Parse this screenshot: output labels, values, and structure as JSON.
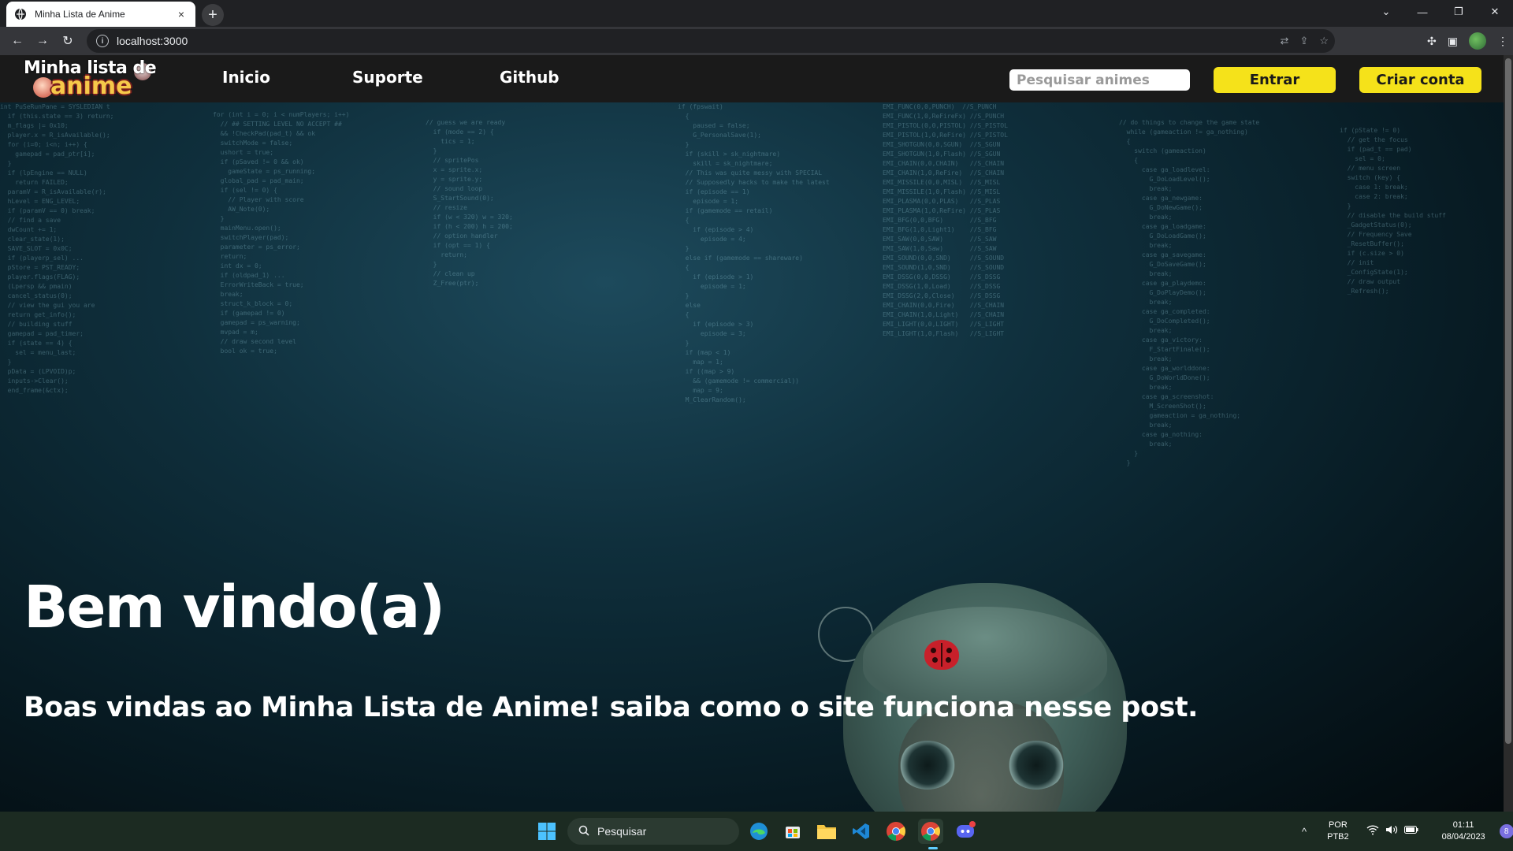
{
  "browser": {
    "tab_title": "Minha Lista de Anime",
    "tab_close": "×",
    "new_tab": "+",
    "url": "localhost:3000",
    "window_controls": {
      "dropdown": "⌄",
      "minimize": "—",
      "maximize": "❐",
      "close": "✕"
    },
    "nav": {
      "back": "←",
      "forward": "→",
      "reload": "↻",
      "info": "i"
    },
    "omnibox_icons": {
      "translate": "⇄",
      "share": "⇪",
      "bookmark": "☆"
    },
    "toolbar_icons": {
      "extensions": "✣",
      "sidepanel": "▣",
      "menu": "⋮"
    }
  },
  "site": {
    "logo_line1": "Minha lista de",
    "logo_line2": "anime",
    "nav_links": [
      "Inicio",
      "Suporte",
      "Github"
    ],
    "search_placeholder": "Pesquisar animes",
    "login_button": "Entrar",
    "signup_button": "Criar conta",
    "hero_title": "Bem vindo(a)",
    "hero_subtitle": "Boas vindas ao Minha Lista de Anime! saiba como o site funciona nesse post.",
    "colors": {
      "accent": "#f5e21a",
      "navbar": "#1a1a1a",
      "text": "#ffffff"
    }
  },
  "taskbar": {
    "search_label": "Pesquisar",
    "language": "POR",
    "keyboard": "PTB2",
    "time": "01:11",
    "date": "08/04/2023",
    "notification_count": "8",
    "chevron": "^",
    "apps": [
      "windows-start-icon",
      "edge-icon",
      "store-icon",
      "file-explorer-icon",
      "vscode-icon",
      "chrome-icon",
      "chrome-active-icon",
      "discord-icon"
    ]
  },
  "background_code": [
    "int PuSeRunPane = SYSLEDIAN t\n  if (this.state == 3) return;\n  m_flags |= 0x10;\n  player.x = R_isAvailable();\n  for (i=0; i<n; i++) {\n    gamepad = pad_ptr[i];\n  }\n  if (lpEngine == NULL)\n    return FAILED;\n  paramV = R_isAvailable(r);\n  hLevel = ENG_LEVEL;\n  if (paramV == 0) break;\n  // find a save\n  dwCount += 1;\n  clear_state(1);\n  SAVE_SLOT = 0x0C;\n  if (playerp_sel) ...\n  pStore = PST_READY;\n  player.flags(FLAG);\n  (Lpersp && pmain)\n  cancel_status(0);\n  // view the gui you are\n  return get_info();\n  // building stuff\n  gamepad = pad_timer;\n  if (state == 4) {\n    sel = menu_last;\n  }\n  pData = (LPVOID)p;\n  inputs->Clear();\n  end_frame(&ctx);",
    "for (int i = 0; i < numPlayers; i++)\n  // ## SETTING LEVEL NO ACCEPT ##\n  && !CheckPad(pad_t) && ok\n  switchMode = false;\n  ushort = true;\n  if (pSaved != 0 && ok)\n    gameState = ps_running;\n  global_pad = pad_main;\n  if (sel != 0) {\n    // Player with score\n    AW_Note(0);\n  }\n  mainMenu.open();\n  switchPlayer(pad);\n  parameter = ps_error;\n  return;\n  int dx = 0;\n  if (oldpad_1) ...\n  ErrorWriteBack = true;\n  break;\n  struct_k_block = 0;\n  if (gamepad != 0)\n  gamepad = ps_warning;\n  mvpad = m;\n  // draw second level\n  bool ok = true;",
    "if (pState != 0)\n  // get the focus\n  if (pad_t == pad)\n    sel = 0;\n  // menu screen\n  switch (key) {\n    case 1: break;\n    case 2: break;\n  }\n  // disable the build stuff\n  _GadgetStatus(0);\n  // Frequency Save\n  _ResetBuffer();\n  if (c.size > 0)\n  // init\n  _ConfigState(1);\n  // draw output\n  _Refresh();",
    "if (fpswait)\n  {\n    paused = false;\n    G_PersonalSave(1);\n  }\n  if (skill > sk_nightmare)\n    skill = sk_nightmare;\n  // This was quite messy with SPECIAL\n  // Supposedly hacks to make the latest\n  if (episode == 1)\n    episode = 1;\n  if (gamemode == retail)\n  {\n    if (episode > 4)\n      episode = 4;\n  }\n  else if (gamemode == shareware)\n  {\n    if (episode > 1)\n      episode = 1;\n  }\n  else\n  {\n    if (episode > 3)\n      episode = 3;\n  }\n  if (map < 1)\n    map = 1;\n  if ((map > 9)\n    && (gamemode != commercial))\n    map = 9;\n  M_ClearRandom();",
    "EMI_FUNC(0,0,PUNCH)  //S_PUNCH\nEMI_FUNC(1,0,ReFireFx) //S_PUNCH\nEMI_PISTOL(0,0,PISTOL) //S_PISTOL\nEMI_PISTOL(1,0,ReFire) //S_PISTOL\nEMI_SHOTGUN(0,0,SGUN)  //S_SGUN\nEMI_SHOTGUN(1,0,Flash) //S_SGUN\nEMI_CHAIN(0,0,CHAIN)   //S_CHAIN\nEMI_CHAIN(1,0,ReFire)  //S_CHAIN\nEMI_MISSILE(0,0,MISL)  //S_MISL\nEMI_MISSILE(1,0,Flash) //S_MISL\nEMI_PLASMA(0,0,PLAS)   //S_PLAS\nEMI_PLASMA(1,0,ReFire) //S_PLAS\nEMI_BFG(0,0,BFG)       //S_BFG\nEMI_BFG(1,0,Light1)    //S_BFG\nEMI_SAW(0,0,SAW)       //S_SAW\nEMI_SAW(1,0,Saw)       //S_SAW\nEMI_SOUND(0,0,SND)     //S_SOUND\nEMI_SOUND(1,0,SND)     //S_SOUND\nEMI_DSSG(0,0,DSSG)     //S_DSSG\nEMI_DSSG(1,0,Load)     //S_DSSG\nEMI_DSSG(2,0,Close)    //S_DSSG\nEMI_CHAIN(0,0,Fire)    //S_CHAIN\nEMI_CHAIN(1,0,Light)   //S_CHAIN\nEMI_LIGHT(0,0,LIGHT)   //S_LIGHT\nEMI_LIGHT(1,0,Flash)   //S_LIGHT",
    "// do things to change the game state\n  while (gameaction != ga_nothing)\n  {\n    switch (gameaction)\n    {\n      case ga_loadlevel:\n        G_DoLoadLevel();\n        break;\n      case ga_newgame:\n        G_DoNewGame();\n        break;\n      case ga_loadgame:\n        G_DoLoadGame();\n        break;\n      case ga_savegame:\n        G_DoSaveGame();\n        break;\n      case ga_playdemo:\n        G_DoPlayDemo();\n        break;\n      case ga_completed:\n        G_DoCompleted();\n        break;\n      case ga_victory:\n        F_StartFinale();\n        break;\n      case ga_worlddone:\n        G_DoWorldDone();\n        break;\n      case ga_screenshot:\n        M_ScreenShot();\n        gameaction = ga_nothing;\n        break;\n      case ga_nothing:\n        break;\n    }\n  }",
    "// guess we are ready\n  if (mode == 2) {\n    tics = 1;\n  }\n  // spritePos\n  x = sprite.x;\n  y = sprite.y;\n  // sound loop\n  S_StartSound(0);\n  // resize\n  if (w < 320) w = 320;\n  if (h < 200) h = 200;\n  // option handler\n  if (opt == 1) {\n    return;\n  }\n  // clean up\n  Z_Free(ptr);"
  ]
}
